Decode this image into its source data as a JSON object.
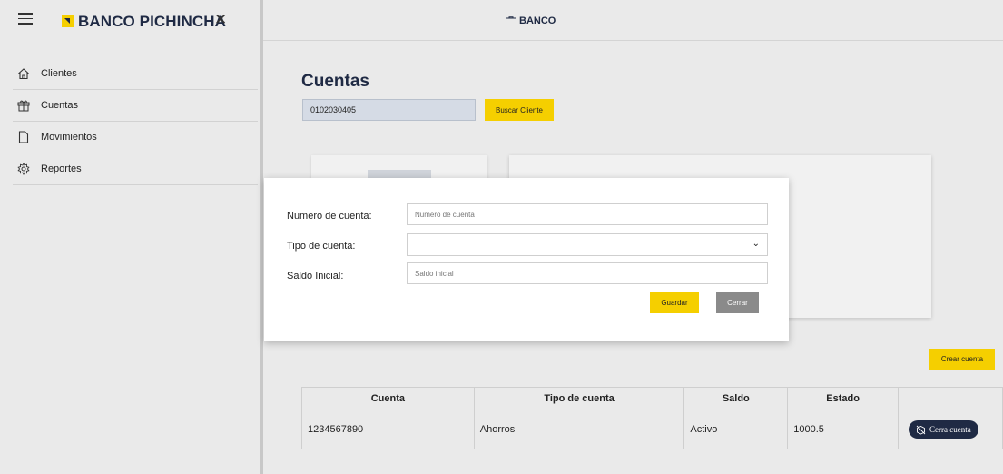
{
  "header": {
    "center_title": "BANCO"
  },
  "sidebar": {
    "brand": "BANCO PICHINCHA",
    "close_symbol": "✕",
    "items": [
      {
        "label": "Clientes",
        "icon": "home-icon"
      },
      {
        "label": "Cuentas",
        "icon": "gift-icon"
      },
      {
        "label": "Movimientos",
        "icon": "file-icon"
      },
      {
        "label": "Reportes",
        "icon": "gear-icon"
      }
    ]
  },
  "main": {
    "title": "Cuentas",
    "search_value": "0102030405",
    "search_button": "Buscar Cliente",
    "create_button": "Crear cuenta"
  },
  "modal": {
    "fields": [
      {
        "label": "Numero de cuenta:",
        "placeholder": "Numero de cuenta"
      },
      {
        "label": "Tipo de cuenta:",
        "value": ""
      },
      {
        "label": "Saldo Inicial:",
        "placeholder": "Saldo inicial"
      }
    ],
    "save_button": "Guardar",
    "close_button": "Cerrar"
  },
  "table": {
    "headers": [
      "Cuenta",
      "Tipo de cuenta",
      "Saldo",
      "Estado",
      ""
    ],
    "rows": [
      {
        "cuenta": "1234567890",
        "tipo": "Ahorros",
        "saldo": "Activo",
        "estado": "1000.5",
        "action": "Cerra cuenta"
      }
    ]
  },
  "colors": {
    "brand_navy": "#1f2a44",
    "accent_yellow": "#f5cf00",
    "button_gray": "#8a8a8a"
  }
}
